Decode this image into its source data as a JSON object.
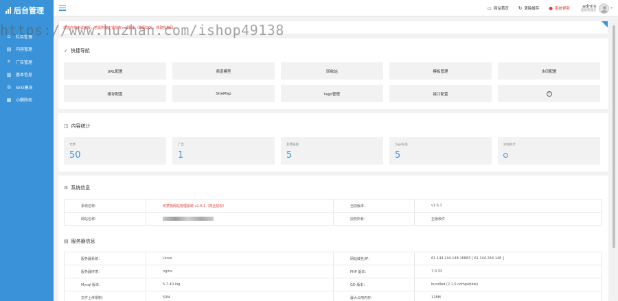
{
  "app": {
    "logo_text": "后台管理"
  },
  "sidebar": {
    "items": [
      {
        "icon": "home-icon",
        "glyph": "⌂",
        "label": "栏目管理"
      },
      {
        "icon": "document-icon",
        "glyph": "▤",
        "label": "内容管理"
      },
      {
        "icon": "megaphone-icon",
        "glyph": "⌾",
        "label": "广告管理"
      },
      {
        "icon": "chart-icon",
        "glyph": "▥",
        "label": "基本信息"
      },
      {
        "icon": "seo-icon",
        "glyph": "◎",
        "label": "SEO模块"
      },
      {
        "icon": "grid-icon",
        "glyph": "▦",
        "label": "小删除权"
      }
    ]
  },
  "topbar": {
    "links": [
      {
        "icon": "monitor-icon",
        "glyph": "▭",
        "label": "网站首页"
      },
      {
        "icon": "refresh-icon",
        "glyph": "↻",
        "label": "清除缓存"
      },
      {
        "icon": "alert-icon",
        "glyph": "●",
        "label": "系统更新"
      }
    ],
    "user": {
      "name": "admin",
      "role": "超级管理员"
    }
  },
  "notice": {
    "text": "您正在使用试用版，若需购买正式授权，请联系（客服QQ），获取授权码。"
  },
  "watermark": "https://www.huzhan.com/ishop49138",
  "quick_nav": {
    "title": "快捷导航",
    "buttons": [
      "URL配置",
      "频道模型",
      "回收站",
      "模板管理",
      "水印配置",
      "缓存配置",
      "SiteMap",
      "tags管理",
      "接口配置",
      "+"
    ]
  },
  "stats": {
    "title": "内容统计",
    "items": [
      {
        "label": "文章",
        "value": "50"
      },
      {
        "label": "广告",
        "value": "1"
      },
      {
        "label": "友情链接",
        "value": "5"
      },
      {
        "label": "Tags标签",
        "value": "5"
      },
      {
        "label": "添加统计",
        "value": ""
      }
    ]
  },
  "system_info": {
    "title": "系统信息",
    "rows": [
      {
        "k1": "系统名称：",
        "v1": "织梦狗网站管理系统 v1.6.1（商业授权）",
        "k2": "当前版本：",
        "v2": "v1.6.1"
      },
      {
        "k1": "网站名称：",
        "v1": "",
        "k2": "授权所有：",
        "v2": "正版软件"
      }
    ]
  },
  "server_info": {
    "title": "服务器信息",
    "rows": [
      {
        "k1": "服务器系统：",
        "v1": "Linux",
        "k2": "网站域名/IP：",
        "v2": "61.144.244.148:16883 [ 61.144.244.148 ]"
      },
      {
        "k1": "服务器环境：",
        "v1": "nginx",
        "k2": "PHP 版本：",
        "v2": "7.0.33"
      },
      {
        "k1": "Mysql 版本：",
        "v1": "5.7.40-log",
        "k2": "GD 版本：",
        "v2": "bundled (2.1.0 compatible)"
      },
      {
        "k1": "文件上传限制：",
        "v1": "50M",
        "k2": "最大占用内存：",
        "v2": "128M"
      }
    ]
  },
  "colors": {
    "primary": "#3a93d8",
    "accent_red": "#e53935",
    "bg": "#f2f2f2"
  }
}
